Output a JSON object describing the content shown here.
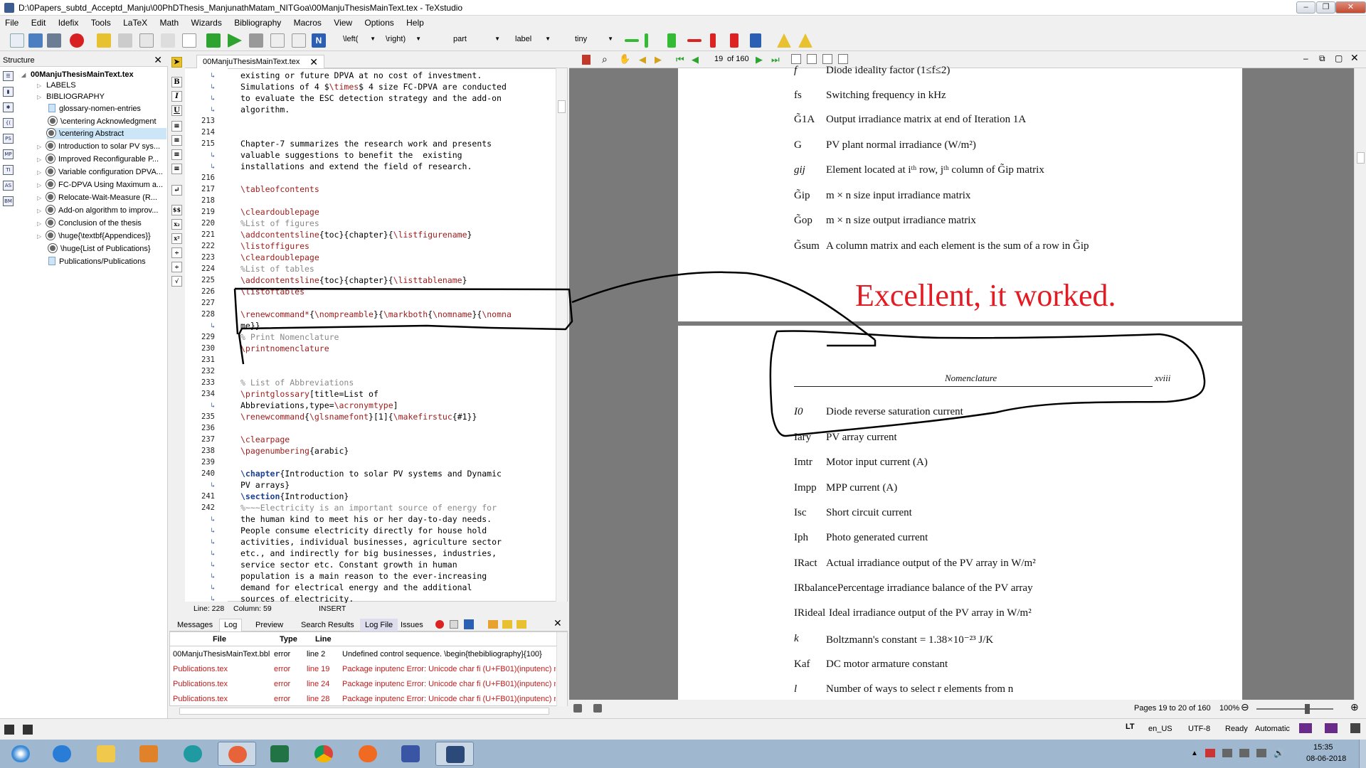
{
  "window": {
    "title": "D:\\0Papers_subtd_Acceptd_Manju\\00PhDThesis_ManjunathMatam_NITGoa\\00ManjuThesisMainText.tex - TeXstudio"
  },
  "menu": [
    "File",
    "Edit",
    "Idefix",
    "Tools",
    "LaTeX",
    "Math",
    "Wizards",
    "Bibliography",
    "Macros",
    "View",
    "Options",
    "Help"
  ],
  "toolbar": {
    "left_combo": "\\left(",
    "right_combo": "\\right)",
    "part_combo": "part",
    "label_combo": "label",
    "size_combo": "tiny"
  },
  "structure": {
    "title": "Structure",
    "root": "00ManjuThesisMainText.tex",
    "items": [
      {
        "label": "LABELS",
        "kind": "folder"
      },
      {
        "label": "BIBLIOGRAPHY",
        "kind": "folder"
      },
      {
        "label": "glossary-nomen-entries",
        "kind": "doc"
      },
      {
        "label": "\\centering Acknowledgment",
        "kind": "section"
      },
      {
        "label": "\\centering Abstract",
        "kind": "section"
      },
      {
        "label": "Introduction to solar PV sys...",
        "kind": "section"
      },
      {
        "label": "Improved Reconfigurable P...",
        "kind": "section"
      },
      {
        "label": "Variable configuration DPVA...",
        "kind": "section"
      },
      {
        "label": "FC-DPVA Using Maximum a...",
        "kind": "section"
      },
      {
        "label": "Relocate-Wait-Measure (R...",
        "kind": "section"
      },
      {
        "label": "Add-on algorithm to improv...",
        "kind": "section"
      },
      {
        "label": "Conclusion of the thesis",
        "kind": "section"
      },
      {
        "label": "\\huge{\\textbf{Appendices}}",
        "kind": "section"
      },
      {
        "label": "\\huge{List of Publications}",
        "kind": "section"
      },
      {
        "label": "Publications/Publications",
        "kind": "doc"
      }
    ]
  },
  "editor": {
    "tab_label": "00ManjuThesisMainText.tex",
    "lines": [
      {
        "n": "",
        "t": "existing or future DPVA at no cost of investment."
      },
      {
        "n": "",
        "t": "Simulations of 4 $\\times$ 4 size FC-DPVA are conducted"
      },
      {
        "n": "",
        "t": "to evaluate the ESC detection strategy and the add-on"
      },
      {
        "n": "",
        "t": "algorithm."
      },
      {
        "n": "213",
        "t": ""
      },
      {
        "n": "214",
        "t": ""
      },
      {
        "n": "215",
        "t": "Chapter-7 summarizes the research work and presents"
      },
      {
        "n": "",
        "t": "valuable suggestions to benefit the  existing"
      },
      {
        "n": "",
        "t": "installations and extend the field of research."
      },
      {
        "n": "216",
        "t": ""
      },
      {
        "n": "217",
        "t": "\\tableofcontents"
      },
      {
        "n": "218",
        "t": ""
      },
      {
        "n": "219",
        "t": "\\cleardoublepage"
      },
      {
        "n": "220",
        "t": "%List of figures"
      },
      {
        "n": "221",
        "t": "\\addcontentsline{toc}{chapter}{\\listfigurename}"
      },
      {
        "n": "222",
        "t": "\\listoffigures"
      },
      {
        "n": "223",
        "t": "\\cleardoublepage"
      },
      {
        "n": "224",
        "t": "%List of tables"
      },
      {
        "n": "225",
        "t": "\\addcontentsline{toc}{chapter}{\\listtablename}"
      },
      {
        "n": "226",
        "t": "\\listoftables"
      },
      {
        "n": "227",
        "t": ""
      },
      {
        "n": "228",
        "t": "\\renewcommand*{\\nompreamble}{\\markboth{\\nomname}{\\nomna"
      },
      {
        "n": "",
        "t": "me}}"
      },
      {
        "n": "229",
        "t": "% Print Nomenclature"
      },
      {
        "n": "230",
        "t": "\\printnomenclature"
      },
      {
        "n": "231",
        "t": ""
      },
      {
        "n": "232",
        "t": ""
      },
      {
        "n": "233",
        "t": "% List of Abbreviations"
      },
      {
        "n": "234",
        "t": "\\printglossary[title=List of"
      },
      {
        "n": "",
        "t": "Abbreviations,type=\\acronymtype]"
      },
      {
        "n": "235",
        "t": "\\renewcommand{\\glsnamefont}[1]{\\makefirstuc{#1}}"
      },
      {
        "n": "236",
        "t": ""
      },
      {
        "n": "237",
        "t": "\\clearpage"
      },
      {
        "n": "238",
        "t": "\\pagenumbering{arabic}"
      },
      {
        "n": "239",
        "t": ""
      },
      {
        "n": "240",
        "t": "\\chapter{Introduction to solar PV systems and Dynamic"
      },
      {
        "n": "",
        "t": "PV arrays}"
      },
      {
        "n": "241",
        "t": "\\section{Introduction}"
      },
      {
        "n": "242",
        "t": "%~~~Electricity is an important source of energy for"
      },
      {
        "n": "",
        "t": "the human kind to meet his or her day-to-day needs."
      },
      {
        "n": "",
        "t": "People consume electricity directly for house hold"
      },
      {
        "n": "",
        "t": "activities, individual businesses, agriculture sector"
      },
      {
        "n": "",
        "t": "etc., and indirectly for big businesses, industries,"
      },
      {
        "n": "",
        "t": "service sector etc. Constant growth in human"
      },
      {
        "n": "",
        "t": "population is a main reason to the ever-increasing"
      },
      {
        "n": "",
        "t": "demand for electrical energy and the additional"
      },
      {
        "n": "",
        "t": "sources of electricity."
      }
    ],
    "status_line": "Line: 228",
    "status_col": "Column: 59",
    "status_mode": "INSERT"
  },
  "log": {
    "tabs": [
      "Messages",
      "Log",
      "Preview",
      "Search Results",
      "Log File",
      "Issues"
    ],
    "active_tab": "Log",
    "columns": [
      "File",
      "Type",
      "Line"
    ],
    "rows": [
      {
        "file": "00ManjuThesisMainText.bbl",
        "type": "error",
        "line": "line 2",
        "msg": "Undefined control sequence. \\begin{thebibliography}{100}"
      },
      {
        "file": "Publications.tex",
        "type": "error",
        "line": "line 19",
        "msg": "Package inputenc Error: Unicode char fi (U+FB01)(inputenc) n"
      },
      {
        "file": "Publications.tex",
        "type": "error",
        "line": "line 24",
        "msg": "Package inputenc Error: Unicode char fi (U+FB01)(inputenc) n"
      },
      {
        "file": "Publications.tex",
        "type": "error",
        "line": "line 28",
        "msg": "Package inputenc Error: Unicode char fi (U+FB01)(inputenc) n"
      }
    ]
  },
  "pdf": {
    "page_field": "19",
    "page_total": "of 160",
    "page1_entries": [
      {
        "sym": "f",
        "desc": "Diode ideality factor (1≤f≤2)"
      },
      {
        "sym": "fs",
        "desc": "Switching frequency in kHz"
      },
      {
        "sym": "G̃1A",
        "desc": "Output irradiance matrix at end of Iteration 1A"
      },
      {
        "sym": "G",
        "desc": "PV plant normal irradiance (W/m²)"
      },
      {
        "sym": "gij",
        "desc": "Element located at iᵗʰ row, jᵗʰ column of G̃ip matrix"
      },
      {
        "sym": "G̃ip",
        "desc": "m × n size input irradiance matrix"
      },
      {
        "sym": "G̃op",
        "desc": "m × n size output irradiance matrix"
      },
      {
        "sym": "G̃sum",
        "desc": "A column matrix and each element is the sum of a row in G̃ip"
      }
    ],
    "annotation": "Excellent, it worked.",
    "header_title": "Nomenclature",
    "header_page": "xviii",
    "page2_entries": [
      {
        "sym": "I0",
        "desc": "Diode reverse saturation current"
      },
      {
        "sym": "Iary",
        "desc": "PV array current"
      },
      {
        "sym": "Imtr",
        "desc": "Motor input current (A)"
      },
      {
        "sym": "Impp",
        "desc": "MPP current (A)"
      },
      {
        "sym": "Isc",
        "desc": "Short circuit current"
      },
      {
        "sym": "Iph",
        "desc": "Photo generated current"
      },
      {
        "sym": "IRact",
        "desc": "Actual irradiance output of the PV array in W/m²"
      },
      {
        "sym": "IRbalance",
        "desc": "Percentage irradiance balance of the PV array"
      },
      {
        "sym": "IRideal",
        "desc": "Ideal irradiance output of the PV array in W/m²"
      },
      {
        "sym": "k",
        "desc": "Boltzmann's constant = 1.38×10⁻²³ J/K"
      },
      {
        "sym": "Kaf",
        "desc": "DC motor armature constant"
      },
      {
        "sym": "l",
        "desc": "Number of ways to select r elements from n"
      }
    ],
    "status_pages": "Pages 19 to 20 of 160",
    "zoom": "100%"
  },
  "statusbar": {
    "language": "en_US",
    "encoding": "UTF-8",
    "state": "Ready",
    "mode": "Automatic"
  },
  "taskbar": {
    "time": "15:35",
    "date": "08-06-2018",
    "apps": [
      "start",
      "internet-explorer",
      "file-explorer",
      "media-player",
      "arduino",
      "firefox-dev",
      "excel",
      "chrome",
      "firefox",
      "visio",
      "texstudio"
    ]
  }
}
